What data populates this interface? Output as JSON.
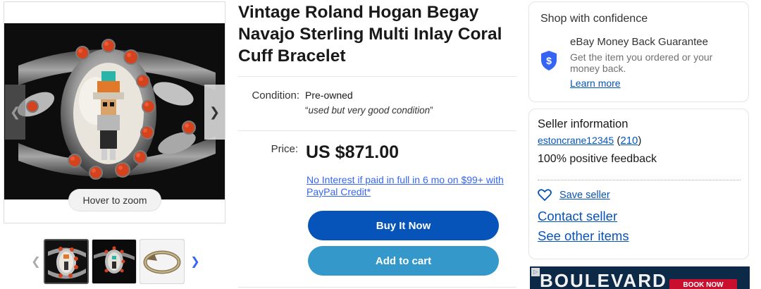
{
  "gallery": {
    "zoom_label": "Hover to zoom",
    "prev_icon": "chevron-left-icon",
    "next_icon": "chevron-right-icon",
    "thumbnails": [
      {
        "label": "thumbnail-1",
        "selected": true
      },
      {
        "label": "thumbnail-2",
        "selected": false
      },
      {
        "label": "thumbnail-3",
        "selected": false
      }
    ]
  },
  "listing": {
    "title": "Vintage Roland Hogan Begay Navajo Sterling Multi Inlay Coral Cuff Bracelet",
    "condition_label": "Condition:",
    "condition_value": "Pre-owned",
    "condition_quote_open": "“",
    "condition_description": "used but very good condition",
    "condition_quote_close": "”",
    "price_label": "Price:",
    "price": "US $871.00",
    "credit_offer": "No Interest if paid in full in 6 mo on $99+ with PayPal Credit*",
    "buy_now_label": "Buy It Now",
    "add_to_cart_label": "Add to cart"
  },
  "confidence": {
    "title": "Shop with confidence",
    "guarantee_title": "eBay Money Back Guarantee",
    "guarantee_desc": "Get the item you ordered or your money back.",
    "learn_more": "Learn more",
    "icon": "shield-dollar-icon"
  },
  "seller": {
    "title": "Seller information",
    "name": "estoncrane12345",
    "open_paren": "(",
    "feedback_count": "210",
    "close_paren": ")",
    "positive_feedback": "100% positive feedback",
    "save_seller": "Save seller",
    "contact_seller": "Contact seller",
    "see_other_items": "See other items"
  },
  "ad": {
    "brand": "BOULEVARD",
    "cta": "BOOK NOW"
  },
  "colors": {
    "link_blue": "#0654ba",
    "buy_now_bg": "#0654ba",
    "add_to_cart_bg": "#3498ca",
    "ad_bg": "#0c2a48",
    "ad_cta": "#c8102e"
  }
}
